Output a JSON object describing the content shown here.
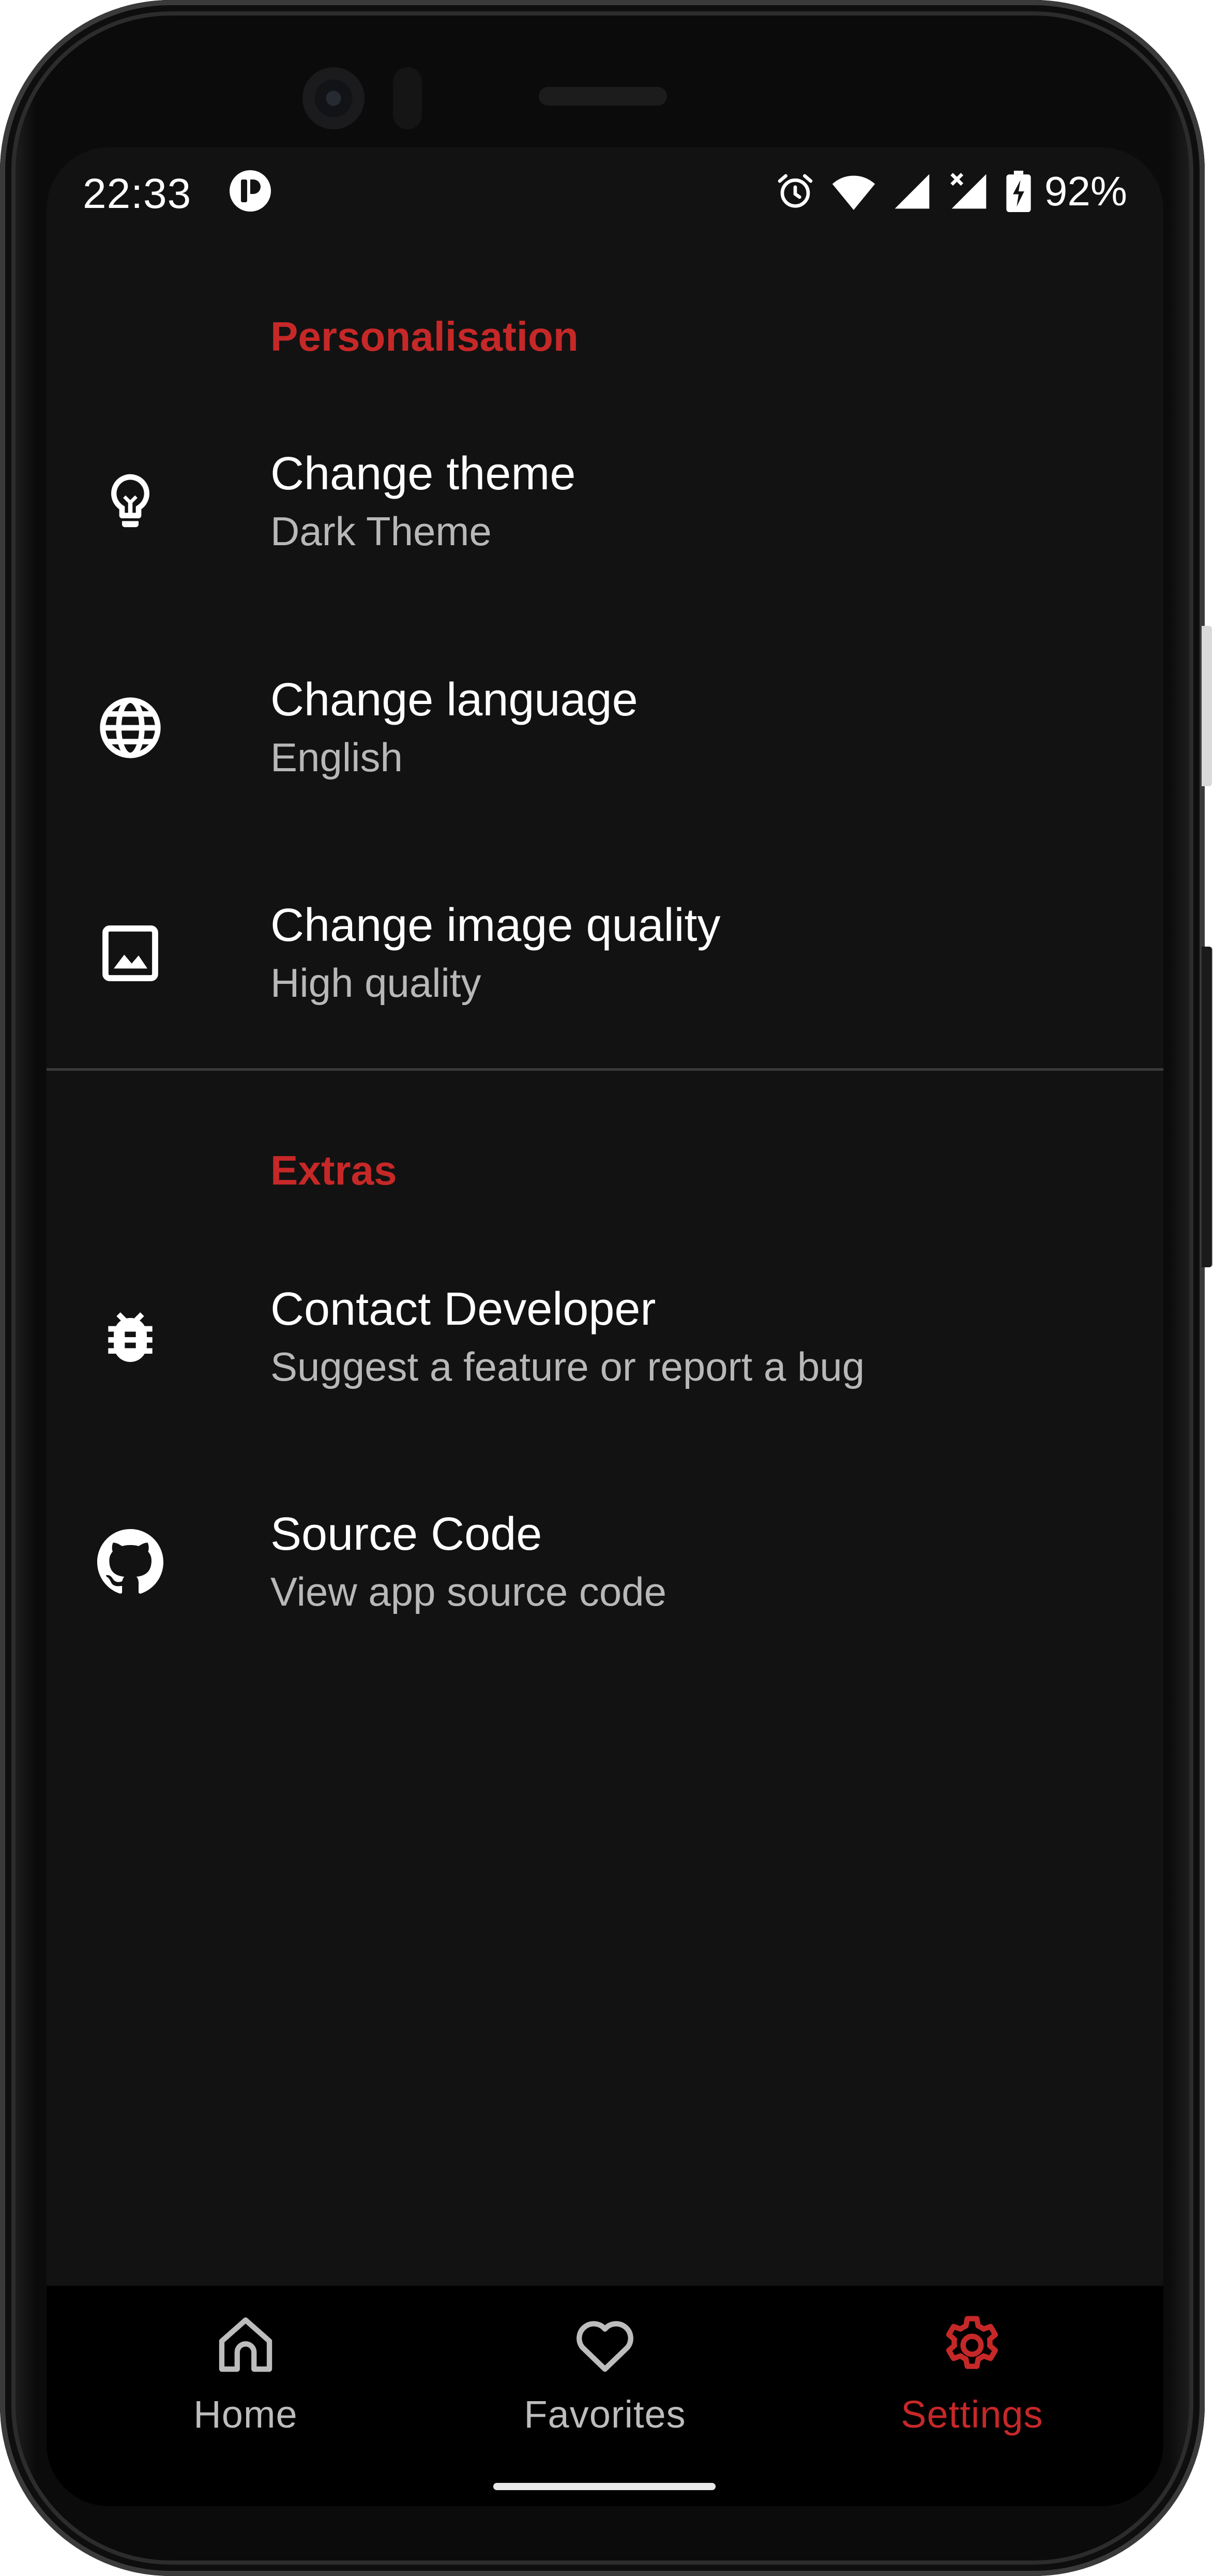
{
  "status_bar": {
    "time": "22:33",
    "app_icon": "p-logo-icon",
    "indicators": [
      "alarm-icon",
      "wifi-icon",
      "signal-icon",
      "signal-no-data-icon",
      "battery-charging-icon"
    ],
    "battery": "92%"
  },
  "sections": [
    {
      "title": "Personalisation",
      "items": [
        {
          "icon": "lightbulb-icon",
          "title": "Change theme",
          "subtitle": "Dark Theme"
        },
        {
          "icon": "globe-icon",
          "title": "Change language",
          "subtitle": "English"
        },
        {
          "icon": "image-icon",
          "title": "Change image quality",
          "subtitle": "High quality"
        }
      ]
    },
    {
      "title": "Extras",
      "items": [
        {
          "icon": "bug-icon",
          "title": "Contact Developer",
          "subtitle": "Suggest a feature or report a bug"
        },
        {
          "icon": "github-icon",
          "title": "Source Code",
          "subtitle": "View app source code"
        }
      ]
    }
  ],
  "bottom_nav": {
    "items": [
      {
        "icon": "home-icon",
        "label": "Home",
        "active": false
      },
      {
        "icon": "heart-icon",
        "label": "Favorites",
        "active": false
      },
      {
        "icon": "gear-icon",
        "label": "Settings",
        "active": true
      }
    ]
  },
  "colors": {
    "background": "#121212",
    "accent": "#c62828",
    "text_primary": "#ffffff",
    "text_secondary": "#b8b8b8",
    "nav_inactive": "#bdbdbd",
    "nav_background": "#000000"
  }
}
